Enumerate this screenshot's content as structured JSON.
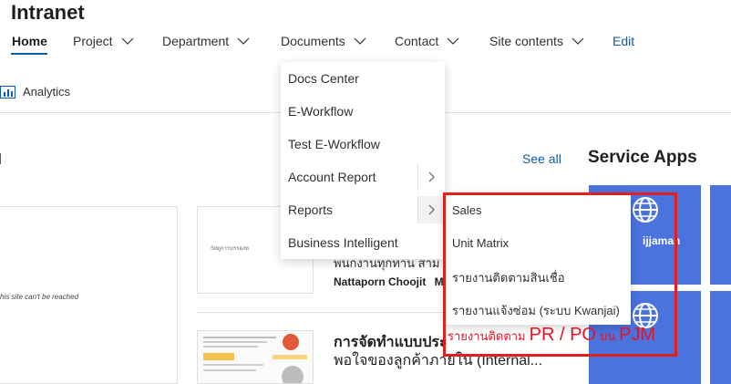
{
  "site": {
    "title": "Intranet"
  },
  "nav": {
    "home": "Home",
    "items": [
      {
        "label": "Project"
      },
      {
        "label": "Department"
      },
      {
        "label": "Documents"
      },
      {
        "label": "Contact"
      },
      {
        "label": "Site contents"
      }
    ],
    "edit": "Edit"
  },
  "toolbar": {
    "analytics": "Analytics"
  },
  "news": {
    "see_all": "See all",
    "left_card_error": "his site can't be reached",
    "item1": {
      "thumb_text": "Sitตูการบรรองท",
      "title_fragment": "พนกงานทุกทาน สาม",
      "author": "Nattaporn Choojit",
      "author_tail": "Ma"
    },
    "item2": {
      "title_line1": "การจัดทำแบบประ",
      "title_line2": "พอใจของลูกค้าภายใน (Internal..."
    }
  },
  "service_apps": {
    "title": "Service Apps",
    "tile_name": "ijjaman"
  },
  "documents_menu": {
    "items": [
      {
        "label": "Docs Center"
      },
      {
        "label": "E-Workflow"
      },
      {
        "label": "Test E-Workflow"
      },
      {
        "label": "Account Report"
      },
      {
        "label": "Reports"
      },
      {
        "label": "Business Intelligent"
      }
    ]
  },
  "reports_submenu": {
    "items": [
      {
        "label": "Sales"
      },
      {
        "label": "Unit Matrix"
      },
      {
        "label": "รายงานติดตามสินเชื่อ"
      },
      {
        "label": "รายงานแจ้งซ่อม (ระบบ Kwanjai)"
      }
    ],
    "pr_po": {
      "prefix": "รายงานติดตาม",
      "codes": "PR / PO",
      "on": "บน",
      "system": "PJM"
    }
  },
  "colors": {
    "accent": "#0f5ca8",
    "tile": "#4a73de",
    "highlight": "#e02020",
    "highlight_text": "#e81123"
  }
}
